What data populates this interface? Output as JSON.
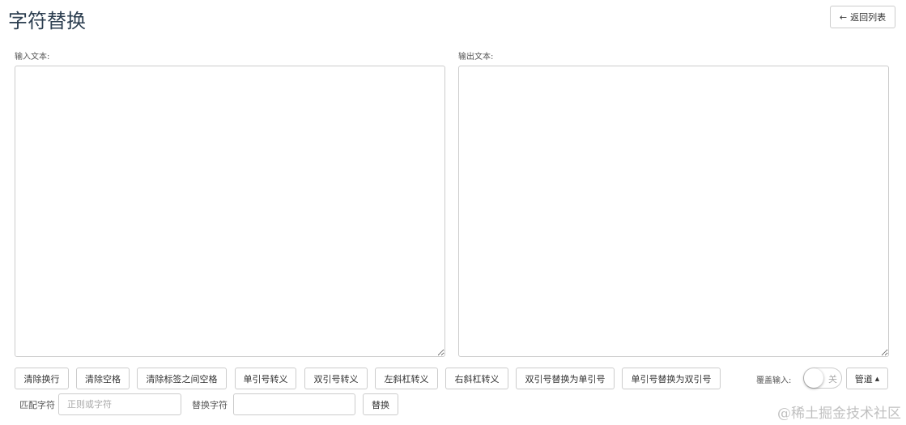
{
  "header": {
    "title": "字符替换",
    "back_label": "返回列表",
    "back_icon": "arrow-left-icon"
  },
  "input": {
    "label": "输入文本:",
    "value": ""
  },
  "output": {
    "label": "输出文本:",
    "value": ""
  },
  "actions": [
    "清除换行",
    "清除空格",
    "清除标签之间空格",
    "单引号转义",
    "双引号转义",
    "左斜杠转义",
    "右斜杠转义",
    "双引号替换为单引号",
    "单引号替换为双引号"
  ],
  "overwrite": {
    "label": "覆盖输入:",
    "state": "关",
    "on": false
  },
  "pipe": {
    "label": "管道",
    "icon": "caret-up-icon"
  },
  "replace": {
    "match_label": "匹配字符",
    "match_placeholder": "正则或字符",
    "match_value": "",
    "replace_label": "替换字符",
    "replace_value": "",
    "button": "替换"
  },
  "watermark": "@稀土掘金技术社区"
}
